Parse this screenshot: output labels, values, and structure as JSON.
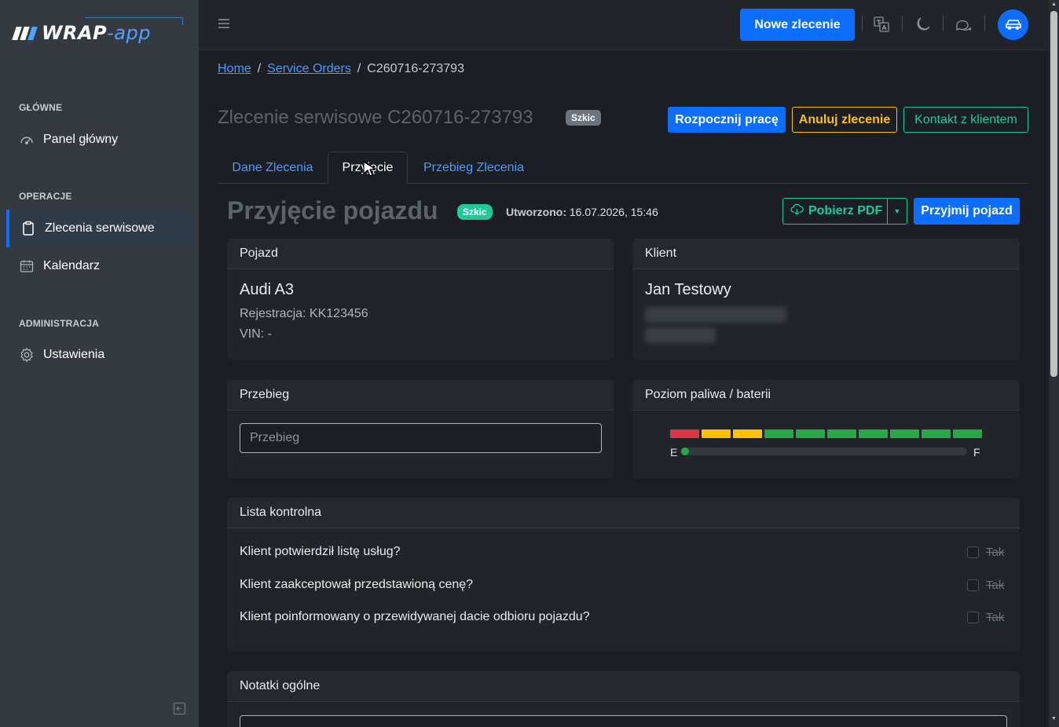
{
  "sidebar": {
    "logo_text_main": "WRAP",
    "logo_text_accent": "-app",
    "sections": [
      {
        "label": "GŁÓWNE",
        "items": [
          {
            "label": "Panel główny",
            "icon": "dashboard-gauge-icon"
          }
        ]
      },
      {
        "label": "OPERACJE",
        "items": [
          {
            "label": "Zlecenia serwisowe",
            "icon": "clipboard-icon",
            "active": true
          },
          {
            "label": "Kalendarz",
            "icon": "calendar-icon"
          }
        ]
      },
      {
        "label": "ADMINISTRACJA",
        "items": [
          {
            "label": "Ustawienia",
            "icon": "gear-icon"
          }
        ]
      }
    ]
  },
  "topbar": {
    "new_order_label": "Nowe zlecenie",
    "icons": [
      "translate-icon",
      "moon-icon",
      "chat-icon"
    ],
    "avatar_icon": "car-icon"
  },
  "breadcrumb": {
    "home": "Home",
    "service_orders": "Service Orders",
    "current": "C260716-273793"
  },
  "header": {
    "title": "Zlecenie serwisowe C260716-273793",
    "status_badge": "Szkic",
    "start_label": "Rozpocznij pracę",
    "cancel_label": "Anuluj zlecenie",
    "contact_label": "Kontakt z klientem"
  },
  "tabs": [
    {
      "label": "Dane Zlecenia",
      "active": false
    },
    {
      "label": "Przyjęcie",
      "active": true
    },
    {
      "label": "Przebieg Zlecenia",
      "active": false
    }
  ],
  "intake": {
    "title": "Przyjęcie pojazdu",
    "status_badge": "Szkic",
    "created_label": "Utworzono:",
    "created_value": "16.07.2026, 15:46",
    "pdf_label": "Pobierz PDF",
    "accept_label": "Przyjmij pojazd",
    "colors": {
      "primary": "#0d6efd",
      "teal": "#20c997",
      "warning": "#ffc107"
    }
  },
  "vehicle": {
    "header": "Pojazd",
    "name": "Audi A3",
    "registration": "Rejestracja: KK123456",
    "vin": "VIN: -"
  },
  "client": {
    "header": "Klient",
    "name": "Jan Testowy"
  },
  "mileage": {
    "header": "Przebieg",
    "placeholder": "Przebieg",
    "value": ""
  },
  "fuel": {
    "header": "Poziom paliwa / baterii",
    "empty_label": "E",
    "full_label": "F",
    "segment_colors": [
      "#dc3545",
      "#ffc107",
      "#ffc107",
      "#28a745",
      "#28a745",
      "#28a745",
      "#28a745",
      "#28a745",
      "#28a745",
      "#28a745"
    ],
    "level_fraction": 0
  },
  "checklist": {
    "header": "Lista kontrolna",
    "items": [
      {
        "question": "Klient potwierdził listę usług?",
        "answer_label": "Tak",
        "checked": false
      },
      {
        "question": "Klient zaakceptował przedstawioną cenę?",
        "answer_label": "Tak",
        "checked": false
      },
      {
        "question": "Klient poinformowany o przewidywanej dacie odbioru pojazdu?",
        "answer_label": "Tak",
        "checked": false
      }
    ]
  },
  "notes": {
    "header": "Notatki ogólne"
  }
}
